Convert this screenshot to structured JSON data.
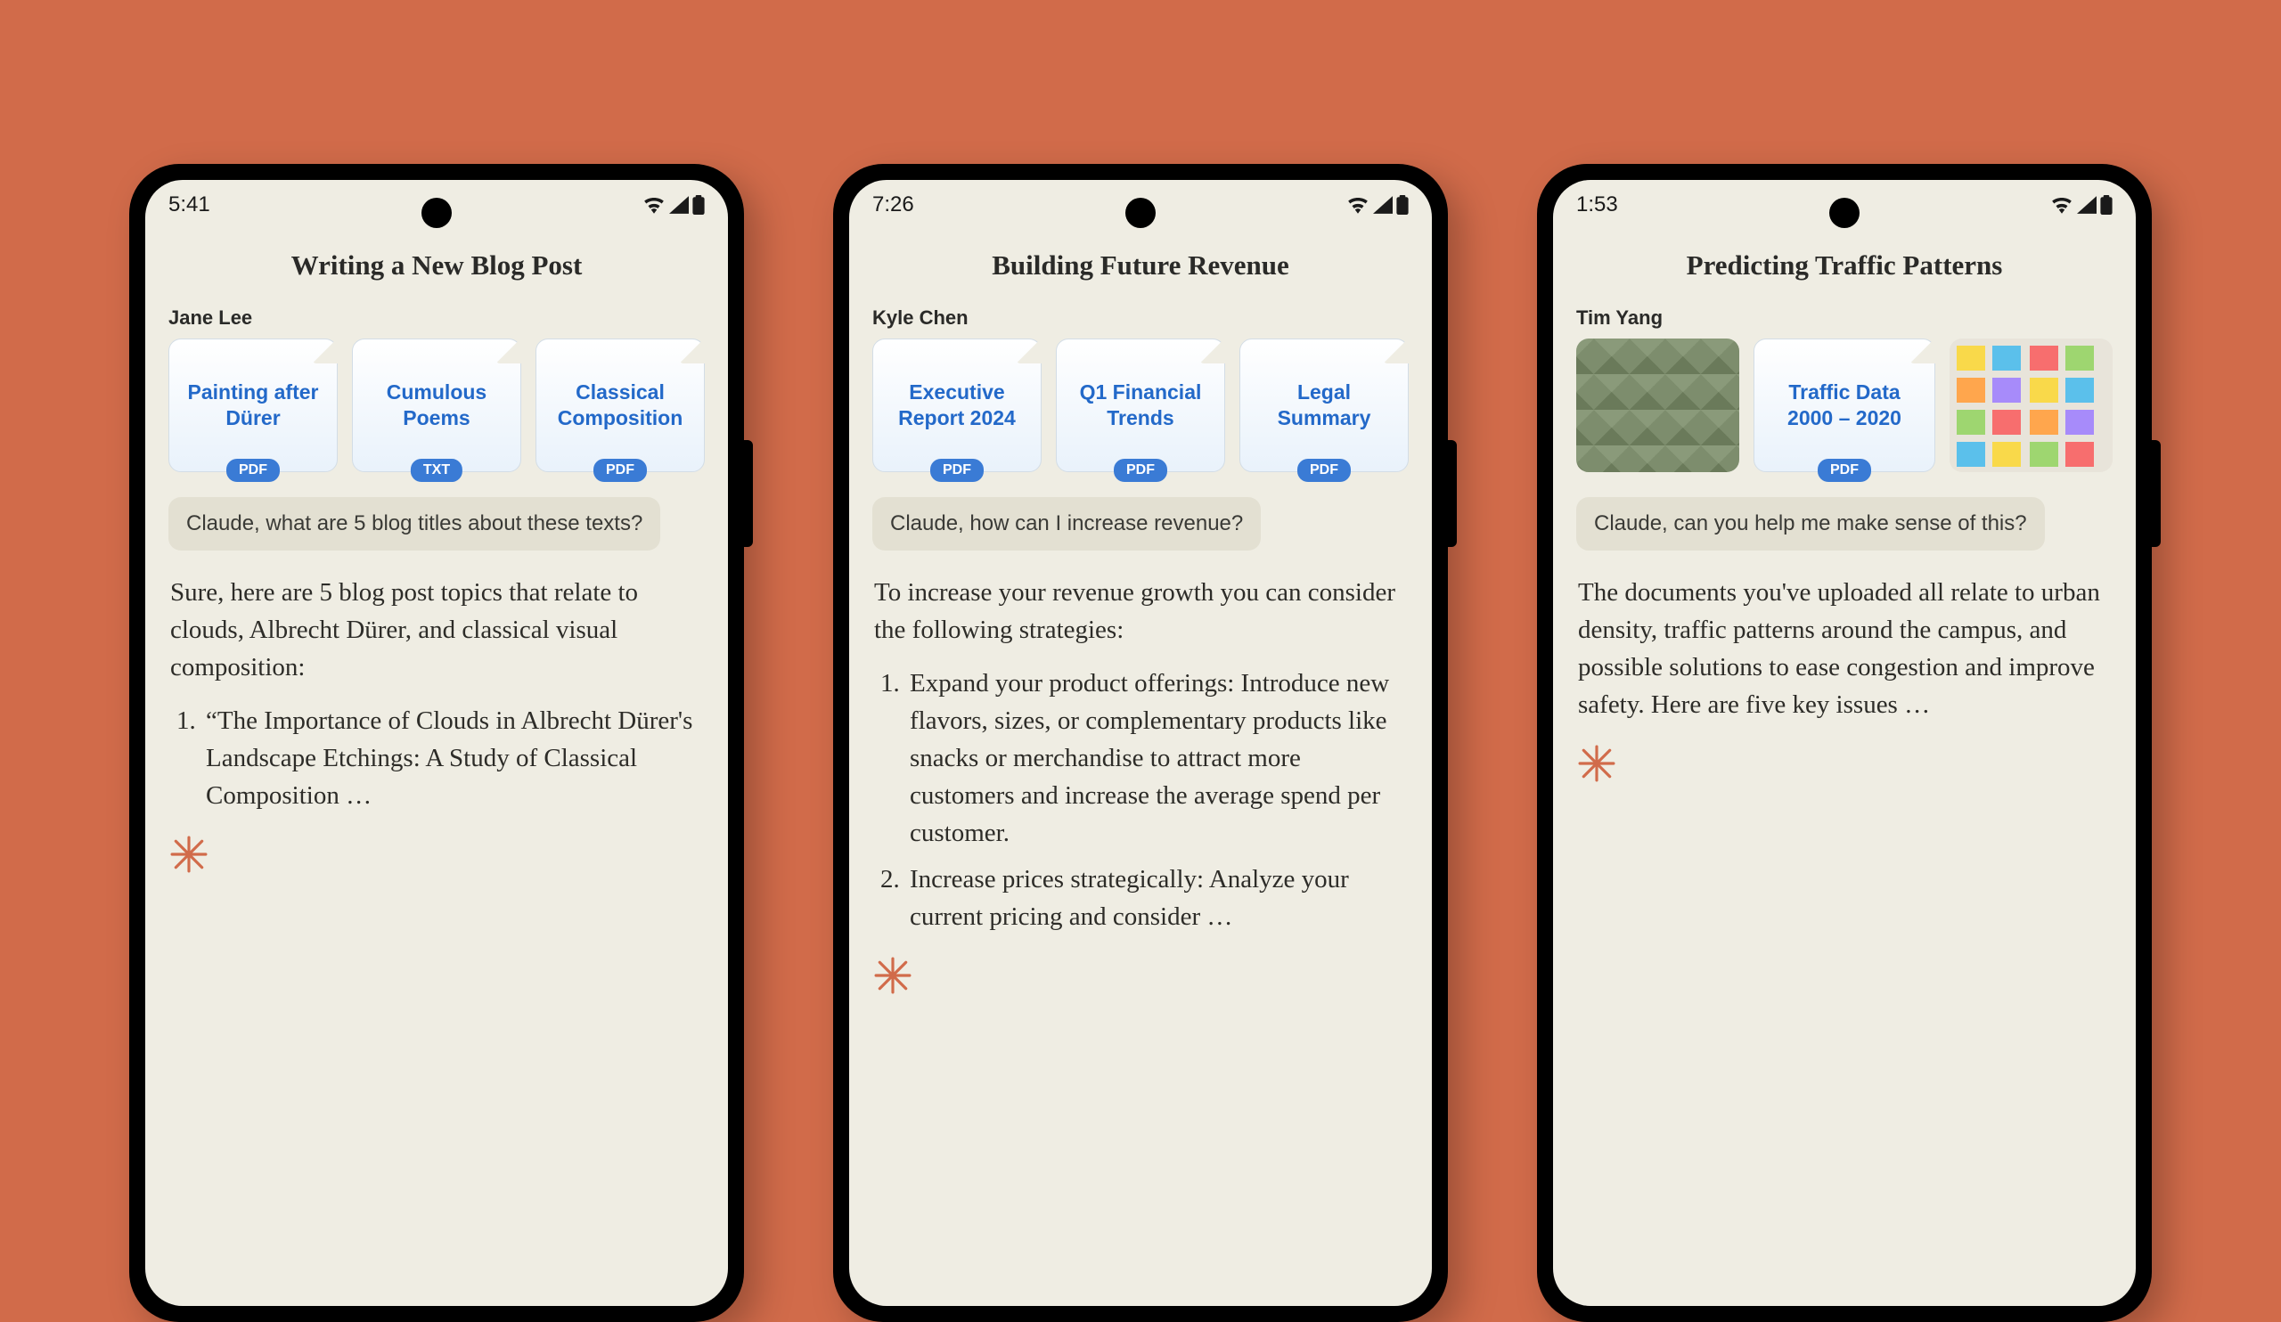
{
  "phones": [
    {
      "time": "5:41",
      "title": "Writing a New Blog Post",
      "user": "Jane Lee",
      "attachments": [
        {
          "kind": "doc",
          "title": "Painting after Dürer",
          "badge": "PDF"
        },
        {
          "kind": "doc",
          "title": "Cumulous Poems",
          "badge": "TXT"
        },
        {
          "kind": "doc",
          "title": "Classical Composition",
          "badge": "PDF"
        }
      ],
      "prompt": "Claude, what are 5 blog titles about these texts?",
      "response_intro": "Sure, here are 5 blog post topics that relate to clouds, Albrecht Dürer, and classical visual composition:",
      "response_items": [
        "“The Importance of Clouds in Albrecht Dürer's Landscape Etchings: A Study of Classical Composition …"
      ]
    },
    {
      "time": "7:26",
      "title": "Building Future Revenue",
      "user": "Kyle Chen",
      "attachments": [
        {
          "kind": "doc",
          "title": "Executive Report 2024",
          "badge": "PDF"
        },
        {
          "kind": "doc",
          "title": "Q1 Financial Trends",
          "badge": "PDF"
        },
        {
          "kind": "doc",
          "title": "Legal Summary",
          "badge": "PDF"
        }
      ],
      "prompt": "Claude, how can I increase revenue?",
      "response_intro": "To increase your revenue growth you can consider the following strategies:",
      "response_items": [
        "Expand your product offerings: Introduce new flavors, sizes, or complementary products like snacks or merchandise to attract more customers and increase the average spend per customer.",
        "Increase prices strategically: Analyze your current pricing and consider …"
      ]
    },
    {
      "time": "1:53",
      "title": "Predicting Traffic Patterns",
      "user": "Tim Yang",
      "attachments": [
        {
          "kind": "image-aerial"
        },
        {
          "kind": "doc",
          "title": "Traffic Data 2000 – 2020",
          "badge": "PDF"
        },
        {
          "kind": "image-stickies"
        }
      ],
      "prompt": "Claude, can you help me make sense of this?",
      "response_intro": "The documents you've uploaded all relate to urban density, traffic patterns around the campus, and possible solutions to ease congestion and improve safety. Here are five key issues …",
      "response_items": []
    }
  ]
}
